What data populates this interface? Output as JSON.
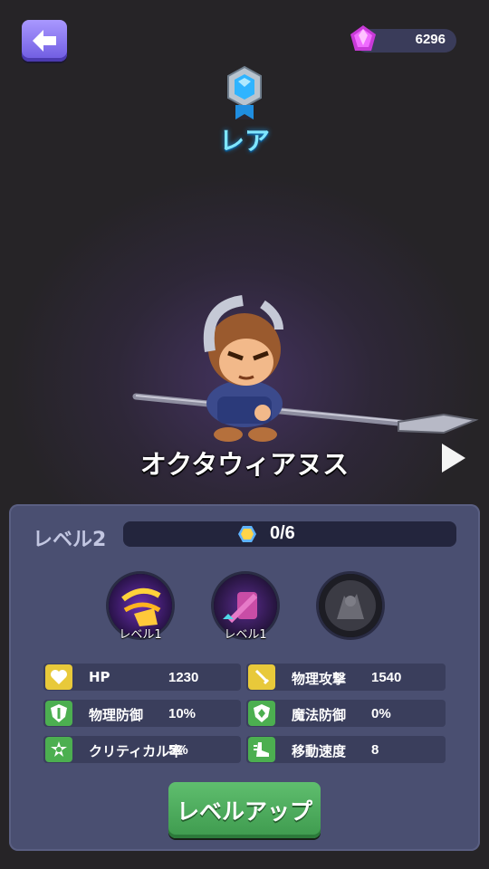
{
  "header": {
    "gem_count": "6296",
    "rarity_label": "レア",
    "icons": [
      "back-arrow-icon",
      "gem-icon",
      "rarity-crystal-icon"
    ]
  },
  "hero": {
    "name": "オクタウィアヌス"
  },
  "panel": {
    "level_label": "レベル2",
    "xp_text": "0/6",
    "skills": [
      {
        "icon": "golden-slash-skill-icon",
        "level": "レベル1"
      },
      {
        "icon": "shield-bash-skill-icon",
        "level": "レベル1"
      },
      {
        "icon": "locked-skill-icon",
        "level": ""
      }
    ],
    "stats": [
      {
        "name": "HP",
        "value": "1230",
        "icon": "heart-icon"
      },
      {
        "name": "物理攻撃",
        "value": "1540",
        "icon": "sword-icon"
      },
      {
        "name": "物理防御",
        "value": "10%",
        "icon": "physical-defense-shield-icon"
      },
      {
        "name": "魔法防御",
        "value": "0%",
        "icon": "magic-defense-shield-icon"
      },
      {
        "name": "クリティカル率",
        "value": "5%",
        "icon": "critical-icon"
      },
      {
        "name": "移動速度",
        "value": "8",
        "icon": "boot-speed-icon"
      }
    ],
    "level_up_label": "レベルアップ"
  },
  "colors": {
    "accent_purple": "#7b68ee",
    "rarity_blue": "#7fe6ff",
    "stat_yellow": "#e8c93a",
    "stat_green": "#4caf50",
    "button_green": "#4caf5a"
  }
}
